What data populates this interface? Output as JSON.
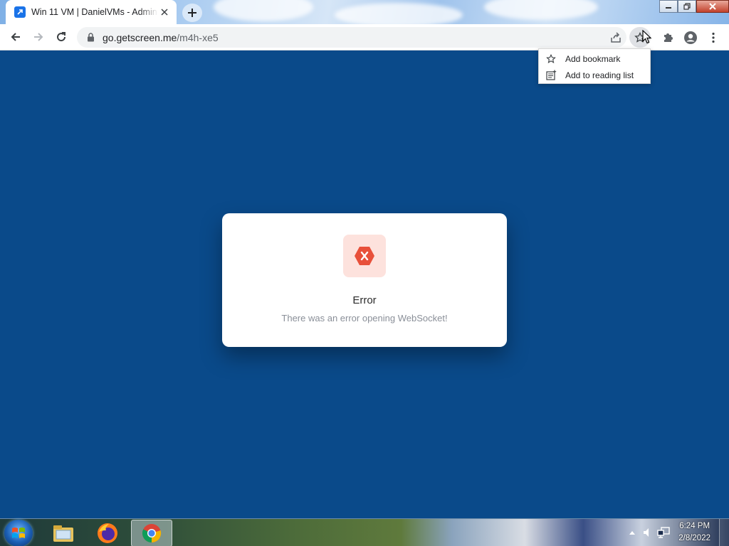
{
  "browser": {
    "tab": {
      "title": "Win 11 VM | DanielVMs - Admin"
    },
    "address_bar": {
      "host": "go.getscreen.me",
      "path": "/m4h-xe5"
    }
  },
  "bookmark_menu": {
    "items": [
      {
        "label": "Add bookmark",
        "icon": "star-outline-icon"
      },
      {
        "label": "Add to reading list",
        "icon": "reading-list-icon"
      }
    ]
  },
  "dialog": {
    "heading": "Error",
    "message": "There was an error opening WebSocket!",
    "icon": "error-hexagon-icon",
    "accent_color": "#e8503a"
  },
  "taskbar": {
    "apps": [
      "file-explorer-icon",
      "firefox-icon",
      "chrome-icon"
    ],
    "clock": {
      "time": "6:24 PM",
      "date": "2/8/2022"
    }
  },
  "colors": {
    "page_background": "#0a4a8a",
    "dialog_background": "#ffffff"
  }
}
